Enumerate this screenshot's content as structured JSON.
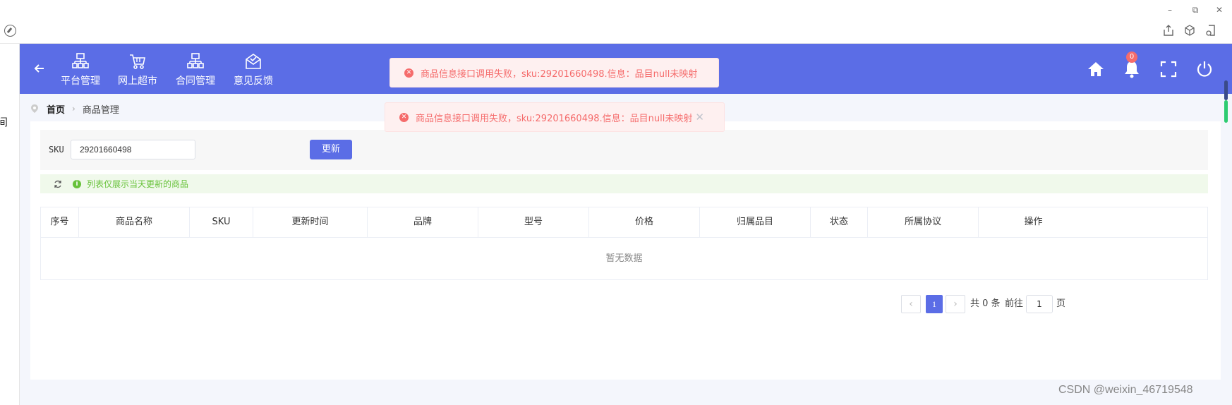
{
  "window_controls": {
    "minimize": "–",
    "restore": "⧉",
    "close": "✕"
  },
  "left_sliver_text": "间",
  "nav": {
    "back_icon": "arrow-left-icon",
    "items": [
      {
        "label": "平台管理",
        "icon": "org-chart-icon"
      },
      {
        "label": "网上超市",
        "icon": "shopping-cart-icon"
      },
      {
        "label": "合同管理",
        "icon": "org-chart-icon"
      },
      {
        "label": "意见反馈",
        "icon": "feedback-mail-icon"
      }
    ],
    "notification_count": "0"
  },
  "breadcrumb": {
    "home": "首页",
    "current": "商品管理"
  },
  "search": {
    "sku_label": "SKU",
    "sku_value": "29201660498",
    "update_label": "更新"
  },
  "info": {
    "text": "列表仅展示当天更新的商品"
  },
  "table": {
    "headers": [
      "序号",
      "商品名称",
      "SKU",
      "更新时间",
      "品牌",
      "型号",
      "价格",
      "归属品目",
      "状态",
      "所属协议",
      "操作"
    ],
    "empty_text": "暂无数据"
  },
  "pagination": {
    "prev": "‹",
    "current_page": "1",
    "next": "›",
    "total_text": "共 0 条",
    "goto_label": "前往",
    "goto_value": "1",
    "page_suffix": "页"
  },
  "toasts": [
    {
      "text": "商品信息接口调用失败，sku:29201660498.信息：品目null未映射",
      "close": ""
    },
    {
      "text": "商品信息接口调用失败，sku:29201660498.信息：品目null未映射",
      "close": "✕"
    }
  ],
  "watermark": "CSDN @weixin_46719548",
  "colors": {
    "primary": "#5b6de6",
    "error": "#f56c6c",
    "success": "#67c23a"
  }
}
